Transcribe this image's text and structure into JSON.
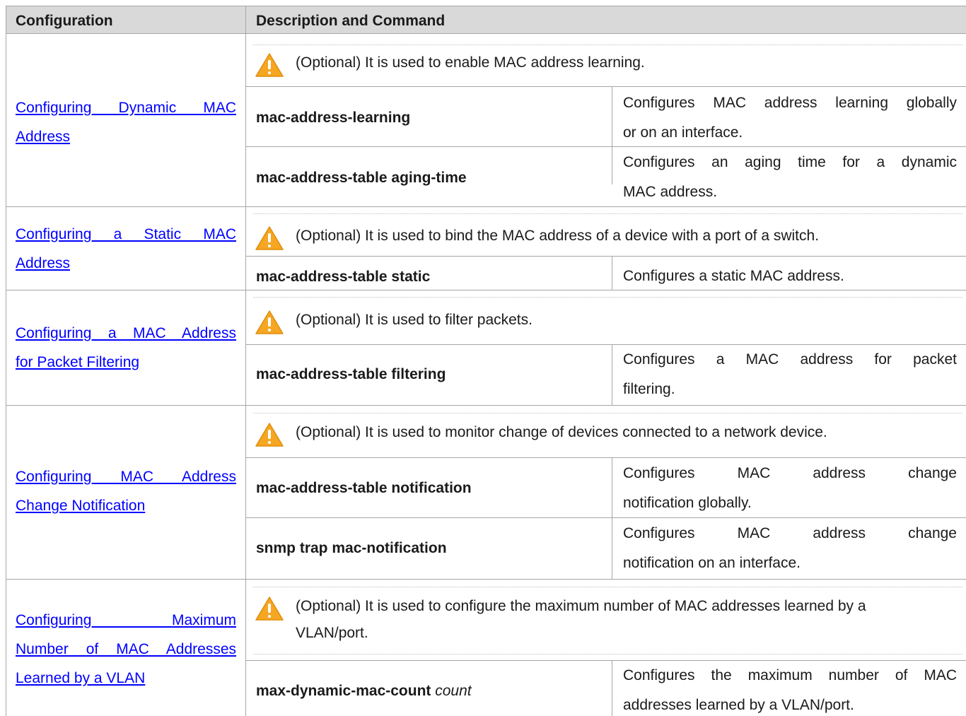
{
  "header": {
    "col1": "Configuration",
    "col2": "Description and Command"
  },
  "sections": [
    {
      "config_line1": "Configuring Dynamic MAC",
      "config_line2": "Address",
      "note": "(Optional) It is used to enable MAC address learning.",
      "commands": [
        {
          "cmd": "mac-address-learning",
          "desc_line1": "Configures MAC address learning globally",
          "desc_line2": "or on an interface."
        },
        {
          "cmd": "mac-address-table aging-time",
          "desc_line1": "Configures an aging time for a dynamic",
          "desc_line2": "MAC address."
        }
      ]
    },
    {
      "config_line1": "Configuring a Static MAC",
      "config_line2": "Address",
      "note": "(Optional) It is used to bind the MAC address of a device with a port of a switch.",
      "commands": [
        {
          "cmd": "mac-address-table static",
          "desc": "Configures a static MAC address."
        }
      ]
    },
    {
      "config_line1": "Configuring a MAC Address",
      "config_line2": "for Packet Filtering",
      "note": "(Optional) It is used to filter packets.",
      "commands": [
        {
          "cmd": "mac-address-table filtering",
          "desc_line1": "Configures a MAC address for packet",
          "desc_line2": "filtering."
        }
      ]
    },
    {
      "config_line1": "Configuring MAC Address",
      "config_line2": "Change Notification",
      "note": "(Optional) It is used to monitor change of devices connected to a network device.",
      "commands": [
        {
          "cmd": "mac-address-table notification",
          "desc_line1": "Configures MAC address change",
          "desc_line2": "notification globally."
        },
        {
          "cmd": "snmp trap mac-notification",
          "desc_line1": "Configures MAC address change",
          "desc_line2": "notification on an interface."
        }
      ]
    },
    {
      "config_line1": "Configuring Maximum",
      "config_line2": "Number of MAC Addresses",
      "config_line3": "Learned by a VLAN",
      "note_line1": "(Optional) It is used to configure the maximum number of MAC addresses learned by a",
      "note_line2": "VLAN/port.",
      "commands": [
        {
          "cmd": "max-dynamic-mac-count",
          "cmd_arg": "count",
          "desc_line1": "Configures the maximum number of MAC",
          "desc_line2": "addresses learned by a VLAN/port."
        }
      ]
    }
  ],
  "colors": {
    "header_bg": "#d9d9d9",
    "link": "#0000ff",
    "border": "#a6a6a6",
    "warning_icon": "#f5a623"
  },
  "icons": {
    "note": "warning-triangle-icon"
  }
}
